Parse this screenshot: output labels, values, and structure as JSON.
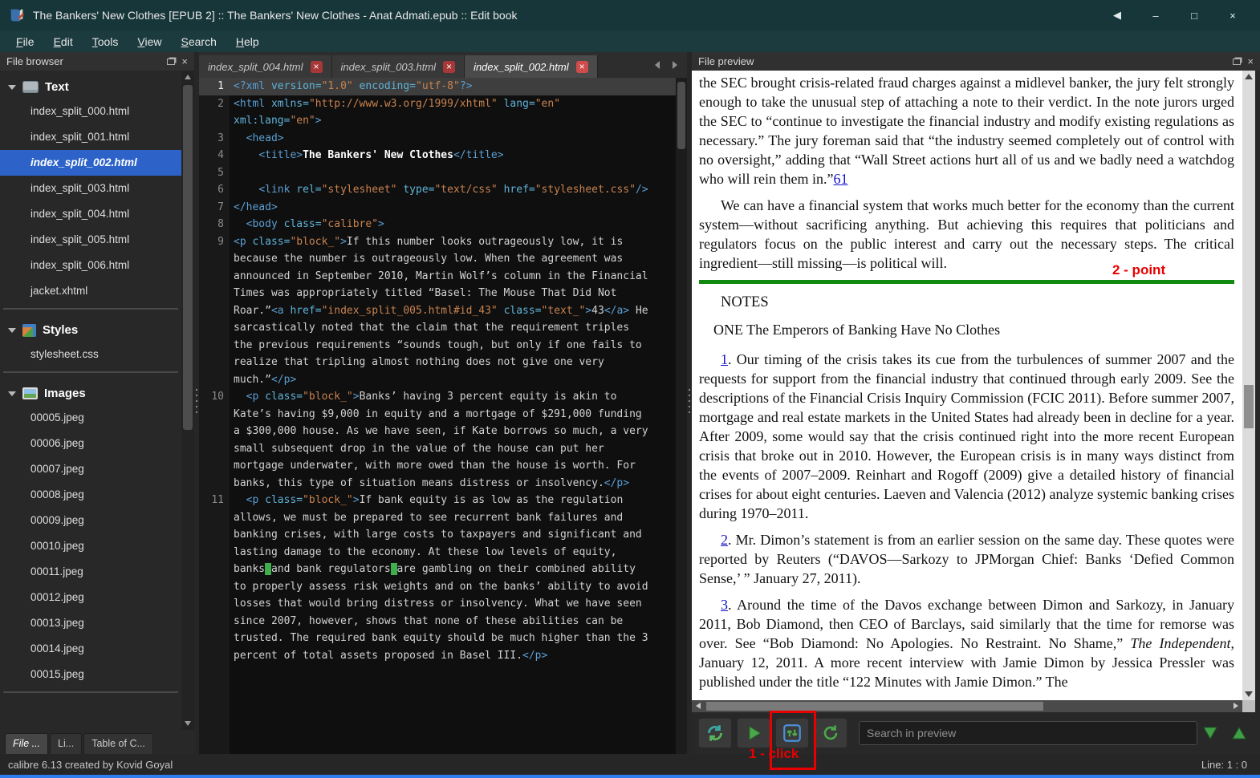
{
  "window": {
    "title": "The Bankers' New Clothes [EPUB 2] :: The Bankers' New Clothes - Anat Admati.epub :: Edit book",
    "controls": [
      {
        "name": "chevron-left",
        "glyph": "◀"
      },
      {
        "name": "minimize",
        "glyph": "–"
      },
      {
        "name": "maximize",
        "glyph": "□"
      },
      {
        "name": "close",
        "glyph": "×"
      }
    ]
  },
  "icons": {
    "close": "×"
  },
  "menu_bar": {
    "items": [
      "File",
      "Edit",
      "Tools",
      "View",
      "Search",
      "Help"
    ]
  },
  "file_browser": {
    "title": "File browser",
    "sections": [
      {
        "name": "Text",
        "icon": "text-files-icon",
        "selected": "index_split_002.html",
        "items": [
          "index_split_000.html",
          "index_split_001.html",
          "index_split_002.html",
          "index_split_003.html",
          "index_split_004.html",
          "index_split_005.html",
          "index_split_006.html",
          "jacket.xhtml"
        ]
      },
      {
        "name": "Styles",
        "icon": "styles-icon",
        "items": [
          "stylesheet.css"
        ]
      },
      {
        "name": "Images",
        "icon": "images-icon",
        "items": [
          "00005.jpeg",
          "00006.jpeg",
          "00007.jpeg",
          "00008.jpeg",
          "00009.jpeg",
          "00010.jpeg",
          "00011.jpeg",
          "00012.jpeg",
          "00013.jpeg",
          "00014.jpeg",
          "00015.jpeg"
        ]
      }
    ],
    "dock_tabs": [
      {
        "label": "File ...",
        "active": true
      },
      {
        "label": "Li...",
        "active": false
      },
      {
        "label": "Table of C...",
        "active": false
      }
    ]
  },
  "editor": {
    "tabs": [
      {
        "label": "index_split_004.html",
        "active": false
      },
      {
        "label": "index_split_003.html",
        "active": false
      },
      {
        "label": "index_split_002.html",
        "active": true
      }
    ],
    "lines": [
      {
        "num": 1,
        "current": true,
        "tokens": [
          [
            "tag",
            "<?xml "
          ],
          [
            "attr",
            "version="
          ],
          [
            "str",
            "\"1.0\""
          ],
          [
            "attr",
            " encoding="
          ],
          [
            "str",
            "\"utf-8\""
          ],
          [
            "tag",
            "?>"
          ]
        ]
      },
      {
        "num": 2,
        "tokens": [
          [
            "tag",
            "<html "
          ],
          [
            "attr",
            "xmlns="
          ],
          [
            "str",
            "\"http://www.w3.org/1999/xhtml\""
          ],
          [
            "attr",
            " lang="
          ],
          [
            "str",
            "\"en\""
          ],
          [
            "attr",
            " xml:lang="
          ],
          [
            "str",
            "\"en\""
          ],
          [
            "tag",
            ">"
          ]
        ]
      },
      {
        "num": 3,
        "tokens": [
          [
            "tag",
            "  <head>"
          ]
        ]
      },
      {
        "num": 4,
        "tokens": [
          [
            "tag",
            "    <title>"
          ],
          [
            "bold",
            "The Bankers' New Clothes"
          ],
          [
            "tag",
            "</title>"
          ]
        ]
      },
      {
        "num": 5,
        "tokens": [
          [
            "txt",
            ""
          ]
        ]
      },
      {
        "num": 6,
        "tokens": [
          [
            "tag",
            "    <link "
          ],
          [
            "attr",
            "rel="
          ],
          [
            "str",
            "\"stylesheet\""
          ],
          [
            "attr",
            " type="
          ],
          [
            "str",
            "\"text/css\""
          ],
          [
            "attr",
            " href="
          ],
          [
            "str",
            "\"stylesheet.css\""
          ],
          [
            "tag",
            "/>"
          ]
        ]
      },
      {
        "num": 7,
        "tokens": [
          [
            "tag",
            "</head>"
          ]
        ]
      },
      {
        "num": 8,
        "tokens": [
          [
            "tag",
            "  <body "
          ],
          [
            "attr",
            "class="
          ],
          [
            "str",
            "\"calibre\""
          ],
          [
            "tag",
            ">"
          ]
        ]
      },
      {
        "num": 9,
        "tokens": [
          [
            "tag",
            "<p "
          ],
          [
            "attr",
            "class="
          ],
          [
            "str",
            "\"block_\""
          ],
          [
            "tag",
            ">"
          ],
          [
            "txt",
            "If this number looks outrageously low, it is because the number is outrageously low. When the agreement was announced in September 2010, Martin Wolf’s column in the Financial Times was appropriately titled “Basel: The Mouse That Did Not Roar.”"
          ],
          [
            "tag",
            "<a "
          ],
          [
            "attr",
            "href="
          ],
          [
            "str",
            "\"index_split_005.html#id_43\""
          ],
          [
            "attr",
            " class="
          ],
          [
            "str",
            "\"text_\""
          ],
          [
            "tag",
            ">"
          ],
          [
            "txt",
            "43"
          ],
          [
            "tag",
            "</a>"
          ],
          [
            "txt",
            " He sarcastically noted that the claim that the requirement triples the previous requirements “sounds tough, but only if one fails to realize that tripling almost nothing does not give one very much.”"
          ],
          [
            "tag",
            "</p>"
          ]
        ]
      },
      {
        "num": 10,
        "tokens": [
          [
            "tag",
            "  <p "
          ],
          [
            "attr",
            "class="
          ],
          [
            "str",
            "\"block_\""
          ],
          [
            "tag",
            ">"
          ],
          [
            "txt",
            "Banks’ having 3 percent equity is akin to Kate’s having $9,000 in equity and a mortgage of $291,000 funding a $300,000 house. As we have seen, if Kate borrows so much, a very small subsequent drop in the value of the house can put her mortgage underwater, with more owed than the house is worth. For banks, this type of situation means distress or insolvency."
          ],
          [
            "tag",
            "</p>"
          ]
        ]
      },
      {
        "num": 11,
        "tokens": [
          [
            "tag",
            "  <p "
          ],
          [
            "attr",
            "class="
          ],
          [
            "str",
            "\"block_\""
          ],
          [
            "tag",
            ">"
          ],
          [
            "txt",
            "If bank equity is as low as the regulation allows, we must be prepared to see recurrent bank failures and banking crises, with large costs to taxpayers and significant and lasting damage to the economy. At these low levels of equity, banks"
          ],
          [
            "mark",
            " "
          ],
          [
            "txt",
            "and bank regulators"
          ],
          [
            "mark",
            " "
          ],
          [
            "txt",
            "are gambling on their combined ability to properly assess risk weights and on the banks’ ability to avoid losses that would bring distress or insolvency. What we have seen since 2007, however, shows that none of these abilities can be trusted. The required bank equity should be much higher than the 3 percent of total assets proposed in Basel III."
          ],
          [
            "tag",
            "</p>"
          ]
        ]
      }
    ]
  },
  "preview": {
    "title": "File preview",
    "divider_color": "#128a12",
    "blocks": [
      {
        "type": "p",
        "indent": false,
        "segments": [
          {
            "t": "the SEC brought crisis-related fraud charges against a midlevel banker, the jury felt strongly enough to take the unusual step of attaching a note to their verdict. In the note jurors urged the SEC to “continue to investigate the financial industry and modify existing regulations as necessary.” The jury foreman said that “the industry seemed completely out of control with no oversight,” adding that “Wall Street actions hurt all of us and we badly need a watchdog who will rein them in.”"
          },
          {
            "t": "61",
            "s": "link"
          }
        ]
      },
      {
        "type": "p",
        "indent": true,
        "segments": [
          {
            "t": "We can have a financial system that works much better for the economy than the current system—without sacrificing anything. But achieving this requires that politicians and regulators focus on the public interest and carry out the necessary steps. The critical ingredient—still missing—is political will."
          }
        ]
      },
      {
        "type": "divider"
      },
      {
        "type": "heading",
        "text": "NOTES"
      },
      {
        "type": "subheading",
        "text": "ONE The Emperors of Banking Have No Clothes"
      },
      {
        "type": "p",
        "indent": true,
        "segments": [
          {
            "t": "1",
            "s": "link"
          },
          {
            "t": ". Our timing of the crisis takes its cue from the turbulences of summer 2007 and the requests for support from the financial industry that continued through early 2009. See the descriptions of the Financial Crisis Inquiry Commission (FCIC 2011). Before summer 2007, mortgage and real estate markets in the United States had already been in decline for a year. After 2009, some would say that the crisis continued right into the more recent European crisis that broke out in 2010. However, the European crisis is in many ways distinct from the events of 2007–2009. Reinhart and Rogoff (2009) give a detailed history of financial crises for about eight centuries. Laeven and Valencia (2012) analyze systemic banking crises during 1970–2011."
          }
        ]
      },
      {
        "type": "p",
        "indent": true,
        "segments": [
          {
            "t": "2",
            "s": "link"
          },
          {
            "t": ". Mr. Dimon’s statement is from an earlier session on the same day. These quotes were reported by Reuters (“DAVOS—Sarkozy to JPMorgan Chief: Banks ‘Defied Common Sense,’ ” January 27, 2011)."
          }
        ]
      },
      {
        "type": "p",
        "indent": true,
        "segments": [
          {
            "t": "3",
            "s": "link"
          },
          {
            "t": ". Around the time of the Davos exchange between Dimon and Sarkozy, in January 2011, Bob Diamond, then CEO of Barclays, said similarly that the time for remorse was over. See “Bob Diamond: No Apologies. No Restraint. No Shame,” "
          },
          {
            "t": "The Independent",
            "s": "italic"
          },
          {
            "t": ", January 12, 2011. A more recent interview with Jamie Dimon by Jessica Pressler was published under the title “122 Minutes with Jamie Dimon.” The"
          }
        ]
      }
    ]
  },
  "preview_toolbar": {
    "buttons": [
      {
        "name": "refresh-preview"
      },
      {
        "name": "run-preview"
      },
      {
        "name": "sync-position"
      },
      {
        "name": "reload-preview"
      }
    ],
    "search_placeholder": "Search in preview"
  },
  "annotations": {
    "point_label": "2 - point",
    "click_label": "1 - click",
    "color": "#e80000"
  },
  "status_bar": {
    "left": "calibre 6.13 created by Kovid Goyal",
    "right": "Line: 1 : 0"
  }
}
